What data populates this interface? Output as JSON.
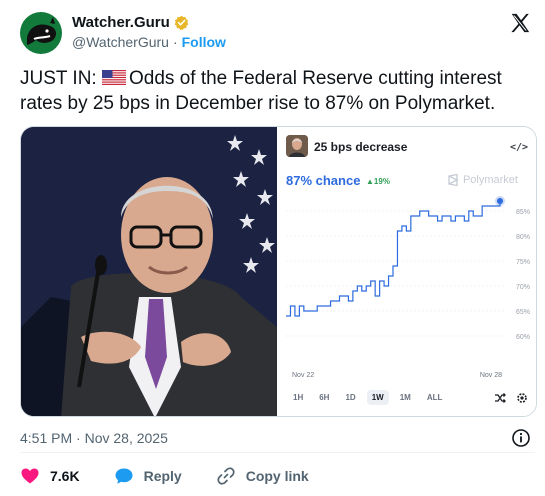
{
  "author": {
    "display_name": "Watcher.Guru",
    "handle": "@WatcherGuru",
    "separator": "·",
    "follow_label": "Follow"
  },
  "tweet": {
    "text_prefix": "JUST IN: ",
    "text_body": "Odds of the Federal Reserve cutting interest rates by 25 bps in December rise to 87% on Polymarket.",
    "flag_icon": "us-flag-icon"
  },
  "polymarket": {
    "title": "25 bps decrease",
    "embed_label": "</>",
    "chance_label": "87% chance",
    "delta_label": "▲19%",
    "brand": "Polymarket",
    "ranges": [
      "1H",
      "6H",
      "1D",
      "1W",
      "1M",
      "ALL"
    ],
    "active_range": "1W",
    "accent_color": "#2d6bde",
    "delta_color": "#2f9e55"
  },
  "chart_data": {
    "type": "line",
    "title": "25 bps decrease",
    "x_labels": [
      "Nov 22",
      "Nov 28"
    ],
    "y_ticks": [
      "85%",
      "80%",
      "75%",
      "70%",
      "65%",
      "60%"
    ],
    "ylim": [
      60,
      87
    ],
    "series": [
      {
        "values": [
          64,
          66,
          64,
          66,
          65,
          65,
          65,
          66,
          66,
          66,
          67,
          67,
          68,
          68,
          67,
          69,
          70,
          69,
          70,
          71,
          68,
          71,
          70,
          72,
          74,
          81,
          82,
          81,
          84,
          84,
          85,
          85,
          84,
          84,
          83,
          84,
          84,
          83,
          84,
          84,
          83,
          85,
          84,
          84,
          86,
          86,
          86,
          86,
          87
        ]
      }
    ]
  },
  "footer": {
    "timestamp": "4:51 PM · Nov 28, 2025",
    "like_count": "7.6K",
    "reply_label": "Reply",
    "copy_link_label": "Copy link"
  }
}
